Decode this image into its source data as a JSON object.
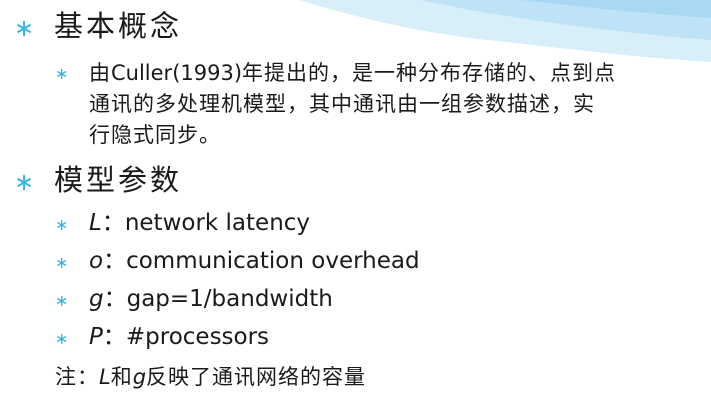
{
  "sections": [
    {
      "heading": "基本概念",
      "paragraph": {
        "prefix": "由",
        "name": "Culler(1993)",
        "line1_rest": "年提出的，是一种分布存储的、点到点",
        "line2": "通讯的多处理机模型，其中通讯由一组参数描述，实",
        "line3": "行隐式同步。"
      }
    },
    {
      "heading": "模型参数",
      "params": [
        {
          "symbol": "L",
          "sep": "：",
          "text": "network latency"
        },
        {
          "symbol": "o",
          "sep": "：",
          "text": "communication overhead"
        },
        {
          "symbol": "g",
          "sep": "：",
          "text": "gap=1/bandwidth"
        },
        {
          "symbol": "P",
          "sep": "：",
          "text": "#processors"
        }
      ]
    }
  ],
  "note": {
    "label": "注：",
    "sym1": "L",
    "mid": "和",
    "sym2": "g",
    "rest": "反映了通讯网络的容量"
  },
  "bullet_glyph": "∗",
  "colors": {
    "bullet": "#35b4e6",
    "wave_light": "#d8eef9",
    "wave_mid": "#a9d9f2",
    "text": "#1a1a1a"
  }
}
